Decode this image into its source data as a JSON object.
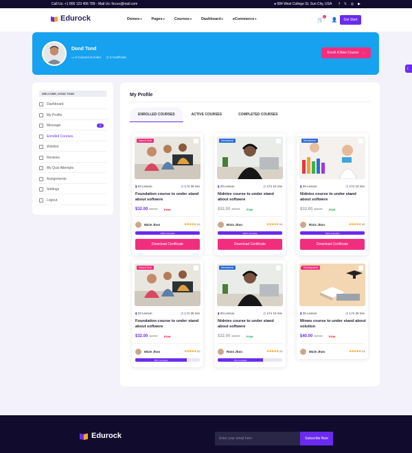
{
  "topbar": {
    "contact": "Call Us: +1 800 123 456 789 - Mail Us: ficcxo@mail.com",
    "address": "684 West College St. Sun City, USA",
    "social_icons": [
      "facebook-icon",
      "twitter-icon",
      "instagram-icon",
      "youtube-icon"
    ]
  },
  "nav": {
    "brand": "Edurock",
    "menu": [
      "Demos",
      "Pages",
      "Courses",
      "Dashboard",
      "eCommerce"
    ],
    "cart_count": "0",
    "cta": "Get Start"
  },
  "profile": {
    "name": "Dond Tond",
    "courses_enrolled": "0 Courses Enroled",
    "certificates": "0 Certificate",
    "cta": "Enroll A New Course"
  },
  "sidebar": {
    "welcome": "WELCOME, DOND TOND",
    "items": [
      {
        "label": "Dashboard",
        "name": "sidebar-item-dashboard"
      },
      {
        "label": "My Profile",
        "name": "sidebar-item-my-profile"
      },
      {
        "label": "Message",
        "name": "sidebar-item-message",
        "badge": "12"
      },
      {
        "label": "Enrolled Courses",
        "name": "sidebar-item-enrolled-courses",
        "active": true
      },
      {
        "label": "Wishlist",
        "name": "sidebar-item-wishlist"
      },
      {
        "label": "Reviews",
        "name": "sidebar-item-reviews"
      },
      {
        "label": "My Quiz Attempts",
        "name": "sidebar-item-quiz-attempts"
      },
      {
        "label": "Assignments",
        "name": "sidebar-item-assignments"
      },
      {
        "label": "Settings",
        "name": "sidebar-item-settings"
      },
      {
        "label": "Logout",
        "name": "sidebar-item-logout"
      }
    ]
  },
  "main": {
    "title": "My Profile",
    "tabs": [
      "ENROLLED COURSES",
      "ACTIVE COURSES",
      "COMPLETED COURSES"
    ]
  },
  "courses": [
    {
      "tag": "Data & Tech",
      "tag_color": "#f12e7e",
      "lessons": "23 Lesson",
      "duration": "1 hr 30 min",
      "title": "Foundation course to under stand about softwere",
      "price": "$32.00",
      "old_price": "$67.00",
      "price_note": "Free",
      "author": "Micle Jhon",
      "reviews": "(44)",
      "progress_label": "100% Complete",
      "progress": 1.0,
      "download": "Download Certificate",
      "photo": "group"
    },
    {
      "tag": "Mechanical",
      "tag_color": "#2b6bd8",
      "lessons": "29 Lesson",
      "duration": "2 hr 10 min",
      "title": "Nidnies course to under stand about softwere",
      "price": "$32.00",
      "old_price": "$69.00",
      "price_note": "Free",
      "author": "Rinis Jhon",
      "reviews": "(44)",
      "progress_label": "100% Complete",
      "progress": 1.0,
      "download": "Download Certificate",
      "photo": "headphones"
    },
    {
      "tag": "Mechanical",
      "tag_color": "#2b6bd8",
      "lessons": "29 Lesson",
      "duration": "2 hr 10 min",
      "title": "Nidnies course to under stand about softwere",
      "price": "$32.00",
      "old_price": "$69.00",
      "price_note": "Free",
      "author": "Rinis Jhon",
      "reviews": "(44)",
      "progress_label": "100% Complete",
      "progress": 1.0,
      "download": "Download Certificate",
      "photo": "lab"
    },
    {
      "tag": "Data & Tech",
      "tag_color": "#f12e7e",
      "lessons": "23 Lesson",
      "duration": "1 hr 30 min",
      "title": "Foundation course to under stand about softwere",
      "price": "$32.00",
      "old_price": "$67.00",
      "price_note": "Free",
      "author": "Micle Jhon",
      "reviews": "(44)",
      "progress_label": "80% Complete",
      "progress": 0.8,
      "photo": "group"
    },
    {
      "tag": "Mechanical",
      "tag_color": "#2b6bd8",
      "lessons": "29 Lesson",
      "duration": "2 hr 10 min",
      "title": "Nidnies course to under stand about softwere",
      "price": "$32.00",
      "old_price": "$69.00",
      "price_note": "Free",
      "author": "Rinis Jhon",
      "reviews": "(44)",
      "progress_label": "70% Complete",
      "progress": 0.7,
      "photo": "headphones"
    },
    {
      "tag": "Development",
      "tag_color": "#f12e7e",
      "lessons": "25 Lesson",
      "duration": "1 hr 40 min",
      "title": "Minws course to under stand about solution",
      "price": "$40.00",
      "old_price": "$67.00",
      "price_note": "Free",
      "author": "Micle Jhon",
      "reviews": "(44)",
      "photo": "books",
      "photo_text": "UCATION"
    }
  ],
  "footer": {
    "brand": "Edurock",
    "email_placeholder": "Enter your email here",
    "subscribe": "Subscribe Now"
  },
  "colors": {
    "accent": "#6a2bef",
    "pink": "#f12e7e",
    "banner": "#16a2ef",
    "footer": "#110c2e"
  }
}
